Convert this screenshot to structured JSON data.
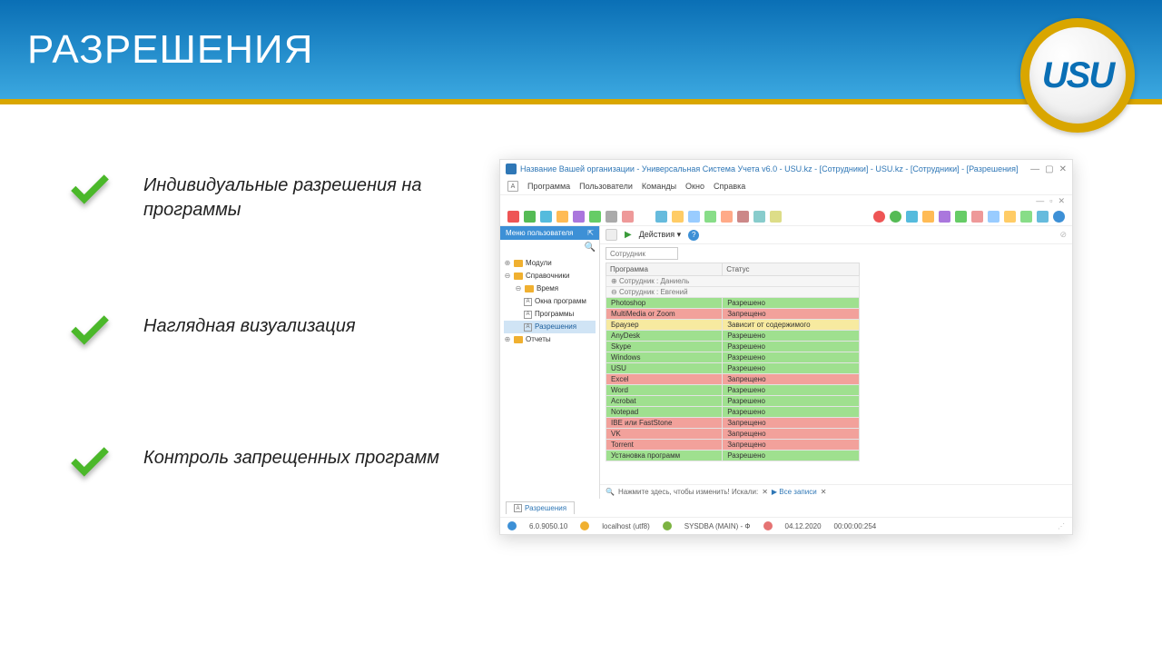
{
  "header": {
    "title": "РАЗРЕШЕНИЯ",
    "logo": "USU"
  },
  "bullets": [
    "Индивидуальные разрешения на программы",
    "Наглядная визуализация",
    "Контроль запрещенных программ"
  ],
  "app": {
    "title": "Название Вашей организации - Универсальная Система Учета v6.0 - USU.kz - [Сотрудники] - USU.kz - [Сотрудники] - [Разрешения]",
    "menu": [
      "Программа",
      "Пользователи",
      "Команды",
      "Окно",
      "Справка"
    ],
    "sidebar": {
      "header": "Меню пользователя",
      "items": {
        "modules": "Модули",
        "refs": "Справочники",
        "time": "Время",
        "windows": "Окна программ",
        "programs": "Программы",
        "permissions": "Разрешения",
        "reports": "Отчеты"
      }
    },
    "actions_label": "Действия",
    "filter": {
      "label": "Сотрудник",
      "value": ""
    },
    "columns": {
      "program": "Программа",
      "status": "Статус"
    },
    "groups": {
      "g1": "Сотрудник : Даниель",
      "g2": "Сотрудник : Евгений"
    },
    "rows": [
      {
        "program": "Photoshop",
        "status": "Разрешено",
        "cls": "green"
      },
      {
        "program": "MultiMedia or Zoom",
        "status": "Запрещено",
        "cls": "red"
      },
      {
        "program": "Браузер",
        "status": "Зависит от содержимого",
        "cls": "yellow"
      },
      {
        "program": "AnyDesk",
        "status": "Разрешено",
        "cls": "green"
      },
      {
        "program": "Skype",
        "status": "Разрешено",
        "cls": "green"
      },
      {
        "program": "Windows",
        "status": "Разрешено",
        "cls": "green"
      },
      {
        "program": "USU",
        "status": "Разрешено",
        "cls": "green"
      },
      {
        "program": "Excel",
        "status": "Запрещено",
        "cls": "red"
      },
      {
        "program": "Word",
        "status": "Разрешено",
        "cls": "green"
      },
      {
        "program": "Acrobat",
        "status": "Разрешено",
        "cls": "green"
      },
      {
        "program": "Notepad",
        "status": "Разрешено",
        "cls": "green"
      },
      {
        "program": "IBE или FastStone",
        "status": "Запрещено",
        "cls": "red"
      },
      {
        "program": "VK",
        "status": "Запрещено",
        "cls": "red"
      },
      {
        "program": "Torrent",
        "status": "Запрещено",
        "cls": "red"
      },
      {
        "program": "Установка программ",
        "status": "Разрешено",
        "cls": "green"
      }
    ],
    "search_hint": "Нажмите здесь, чтобы изменить! Искали:",
    "search_scope": "Все записи",
    "tab": "Разрешения",
    "status": {
      "version": "6.0.9050.10",
      "host": "localhost (utf8)",
      "user": "SYSDBA (MAIN) - Ф",
      "date": "04.12.2020",
      "time": "00:00:00:254"
    }
  }
}
